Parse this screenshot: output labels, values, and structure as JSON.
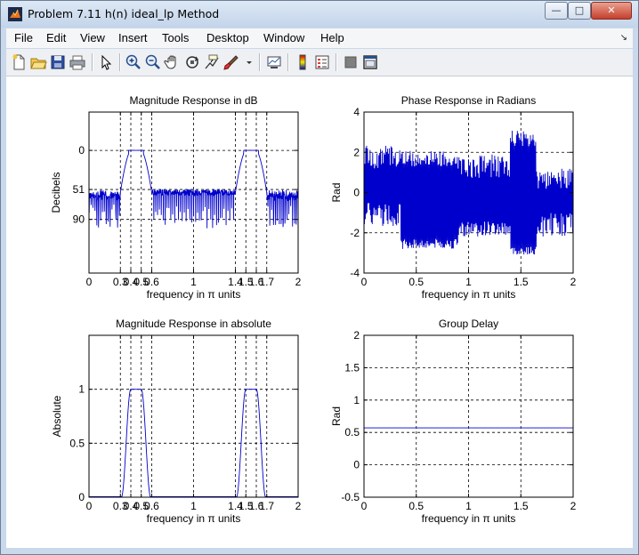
{
  "window": {
    "title": "Problem 7.11 h(n) ideal_lp Method",
    "controls": {
      "minimize": "—",
      "maximize": "□",
      "close": "✕"
    }
  },
  "menu": [
    "File",
    "Edit",
    "View",
    "Insert",
    "Tools",
    "Desktop",
    "Window",
    "Help"
  ],
  "toolbar": {
    "icons": [
      "new-file-icon",
      "open-folder-icon",
      "save-icon",
      "print-icon",
      "pointer-icon",
      "zoom-in-icon",
      "zoom-out-icon",
      "pan-hand-icon",
      "rotate-3d-icon",
      "data-cursor-icon",
      "brush-icon",
      "brush-dropdown-icon",
      "link-plot-icon",
      "colorbar-icon",
      "legend-icon",
      "hide-plot-tools-icon",
      "show-plot-tools-icon"
    ]
  },
  "colors": {
    "line": "#0000cc",
    "grid": "#000000"
  },
  "chart_data": [
    {
      "type": "line",
      "title": "Magnitude Response in dB",
      "xlabel": "frequency in π units",
      "ylabel": "Decibels",
      "xlim": [
        0,
        2
      ],
      "ylim": [
        -160,
        50
      ],
      "y_reversed_ticks": true,
      "xticks": [
        "0",
        "0.3",
        "0.4",
        "0.5",
        "0.6",
        "1",
        "1.4",
        "1.5",
        "1.6",
        "1.7",
        "2"
      ],
      "xtick_values": [
        0,
        0.3,
        0.4,
        0.5,
        0.6,
        1,
        1.4,
        1.5,
        1.6,
        1.7,
        2
      ],
      "yticks": [
        "0",
        "51",
        "90"
      ],
      "ytick_values": [
        0,
        -51,
        -90
      ],
      "grid": true,
      "description": "Bandpass filter magnitude in dB, passbands 0.4–0.5 and 1.5–1.6, stopband ripple ~ -51 to -90 dB",
      "passbands": [
        [
          0.4,
          0.5
        ],
        [
          1.5,
          1.6
        ]
      ],
      "transition_edges": [
        0.3,
        0.6,
        1.4,
        1.7
      ],
      "passband_level": 0,
      "stopband_level": -51,
      "stopband_min": -90
    },
    {
      "type": "line",
      "title": "Phase Response in Radians",
      "xlabel": "frequency in π units",
      "ylabel": "Rad",
      "xlim": [
        0,
        2
      ],
      "ylim": [
        -4,
        4
      ],
      "xticks": [
        "0",
        "0.5",
        "1",
        "1.5",
        "2"
      ],
      "xtick_values": [
        0,
        0.5,
        1,
        1.5,
        2
      ],
      "yticks": [
        "-4",
        "-2",
        "0",
        "2",
        "4"
      ],
      "ytick_values": [
        -4,
        -2,
        0,
        2,
        4
      ],
      "grid": true,
      "amplitude_range": [
        -3.14,
        3.14
      ]
    },
    {
      "type": "line",
      "title": "Magnitude Response in absolute",
      "xlabel": "frequency in π units",
      "ylabel": "Absolute",
      "xlim": [
        0,
        2
      ],
      "ylim": [
        0,
        1.5
      ],
      "xticks": [
        "0",
        "0.3",
        "0.4",
        "0.5",
        "0.6",
        "1",
        "1.4",
        "1.5",
        "1.6",
        "1.7",
        "2"
      ],
      "xtick_values": [
        0,
        0.3,
        0.4,
        0.5,
        0.6,
        1,
        1.4,
        1.5,
        1.6,
        1.7,
        2
      ],
      "yticks": [
        "0",
        "0.5",
        "1"
      ],
      "ytick_values": [
        0,
        0.5,
        1
      ],
      "grid": true,
      "passbands": [
        [
          0.4,
          0.5
        ],
        [
          1.5,
          1.6
        ]
      ],
      "passband_level": 1
    },
    {
      "type": "line",
      "title": "Group Delay",
      "xlabel": "frequency in π units",
      "ylabel": "Rad",
      "xlim": [
        0,
        2
      ],
      "ylim": [
        -0.5,
        2
      ],
      "xticks": [
        "0",
        "0.5",
        "1",
        "1.5",
        "2"
      ],
      "xtick_values": [
        0,
        0.5,
        1,
        1.5,
        2
      ],
      "yticks": [
        "-0.5",
        "0",
        "0.5",
        "1",
        "1.5",
        "2"
      ],
      "ytick_values": [
        -0.5,
        0,
        0.5,
        1,
        1.5,
        2
      ],
      "grid": true,
      "x": [
        0,
        2
      ],
      "y": [
        0.57,
        0.57
      ]
    }
  ]
}
